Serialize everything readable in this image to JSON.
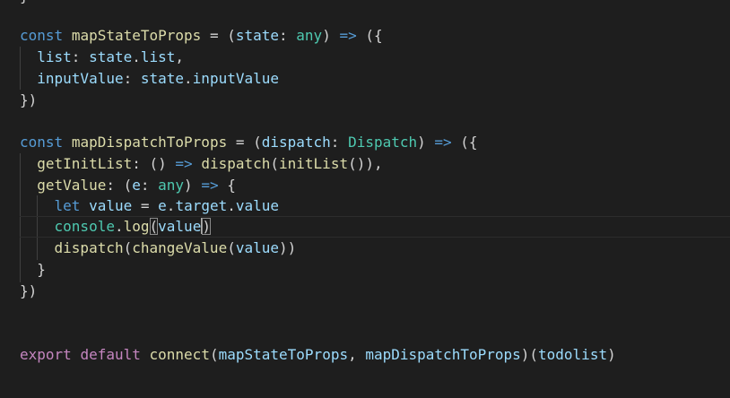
{
  "editor": {
    "tokens": {
      "top_brace": "}",
      "l1_const": "const",
      "l1_name": "mapStateToProps",
      "l1_eq": " = (",
      "l1_param": "state",
      "l1_colon": ": ",
      "l1_type": "any",
      "l1_end": ") ",
      "l1_arrow": "=>",
      "l1_paren": " ({",
      "l2_prop": "list",
      "l2_colon": ": ",
      "l2_obj": "state",
      "l2_dot": ".",
      "l2_member": "list",
      "l2_comma": ",",
      "l3_prop": "inputValue",
      "l3_colon": ": ",
      "l3_obj": "state",
      "l3_dot": ".",
      "l3_member": "inputValue",
      "l4_close": "})",
      "l6_const": "const",
      "l6_name": "mapDispatchToProps",
      "l6_eq": " = (",
      "l6_param": "dispatch",
      "l6_colon": ": ",
      "l6_type": "Dispatch",
      "l6_end": ") ",
      "l6_arrow": "=>",
      "l6_paren": " ({",
      "l7_fn": "getInitList",
      "l7_colon": ": () ",
      "l7_arrow": "=>",
      "l7_sp": " ",
      "l7_call": "dispatch",
      "l7_open": "(",
      "l7_inner": "initList",
      "l7_close": "()),",
      "l8_fn": "getValue",
      "l8_colon": ": (",
      "l8_param": "e",
      "l8_colon2": ": ",
      "l8_type": "any",
      "l8_end": ") ",
      "l8_arrow": "=>",
      "l8_brace": " {",
      "l9_let": "let",
      "l9_sp": " ",
      "l9_var": "value",
      "l9_eq": " = ",
      "l9_obj": "e",
      "l9_dot": ".",
      "l9_target": "target",
      "l9_dot2": ".",
      "l9_value": "value",
      "l10_console": "console",
      "l10_dot": ".",
      "l10_log": "log",
      "l10_open": "(",
      "l10_arg": "value",
      "l10_close": ")",
      "l11_call": "dispatch",
      "l11_open": "(",
      "l11_inner": "changeValue",
      "l11_open2": "(",
      "l11_arg": "value",
      "l11_close": "))",
      "l12_close": "}",
      "l13_close": "})",
      "l16_export": "export",
      "l16_sp": " ",
      "l16_default": "default",
      "l16_sp2": " ",
      "l16_connect": "connect",
      "l16_open": "(",
      "l16_arg1": "mapStateToProps",
      "l16_comma": ", ",
      "l16_arg2": "mapDispatchToProps",
      "l16_mid": ")(",
      "l16_arg3": "todolist",
      "l16_close": ")"
    }
  }
}
